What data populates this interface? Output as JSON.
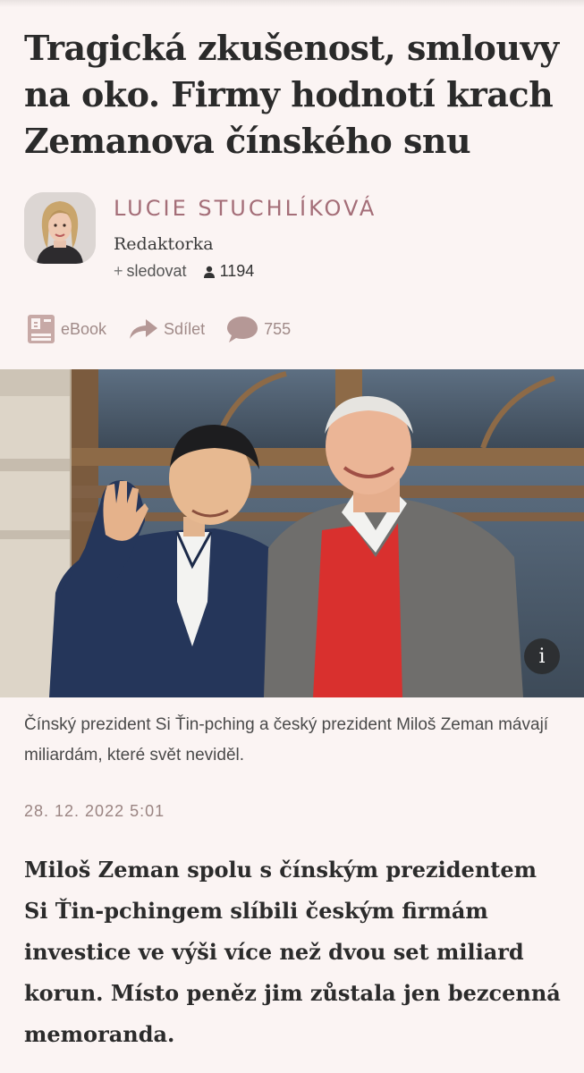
{
  "article": {
    "headline": "Tragická zkušenost, smlouvy na oko. Firmy hodnotí krach Zemanova čínského snu",
    "author": {
      "name": "Lucie Stuchlíková",
      "role": "Redaktorka",
      "follow_label": "sledovat",
      "follow_prefix": "+",
      "followers_count": "1194"
    },
    "actions": {
      "ebook_label": "eBook",
      "share_label": "Sdílet",
      "comments_count": "755"
    },
    "photo": {
      "info_label": "i",
      "caption": "Čínský prezident Si Ťin-pching a český prezident Miloš Zeman mávají miliardám, které svět neviděl."
    },
    "date": "28. 12. 2022 5:01",
    "perex": "Miloš Zeman spolu s čínským prezidentem Si Ťin-pchingem slíbili českým firmám investice ve výši více než dvou set miliard korun. Místo peněz jim zůstala jen bezcenná memoranda."
  },
  "colors": {
    "background": "#fbf4f3",
    "accent": "#a46e78",
    "muted_icon": "#a08a88",
    "text": "#2b2b2b"
  },
  "icons": {
    "ebook": "ebook-icon",
    "share": "share-arrow-icon",
    "comments": "comment-bubble-icon",
    "followers": "person-icon",
    "info": "info-icon"
  }
}
